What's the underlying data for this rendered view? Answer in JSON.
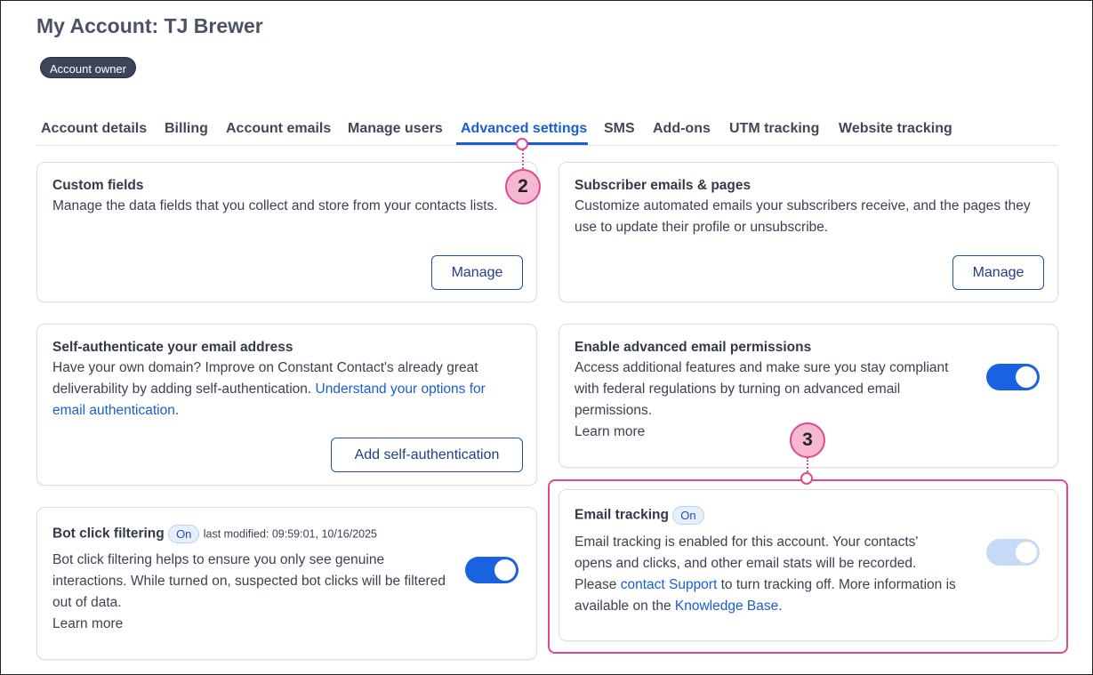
{
  "page": {
    "title": "My Account: TJ Brewer",
    "role_badge": "Account owner"
  },
  "tabs": [
    {
      "label": "Account details"
    },
    {
      "label": "Billing"
    },
    {
      "label": "Account emails"
    },
    {
      "label": "Manage users"
    },
    {
      "label": "Advanced settings",
      "active": true
    },
    {
      "label": "SMS"
    },
    {
      "label": "Add-ons"
    },
    {
      "label": "UTM tracking"
    },
    {
      "label": "Website tracking"
    }
  ],
  "cards": {
    "custom_fields": {
      "title": "Custom fields",
      "description": "Manage the data fields that you collect and store from your contacts lists.",
      "button": "Manage"
    },
    "subscriber_emails": {
      "title": "Subscriber emails & pages",
      "description": "Customize automated emails your subscribers receive, and the pages they use to update their profile or unsubscribe.",
      "button": "Manage"
    },
    "self_auth": {
      "title": "Self-authenticate your email address",
      "description_prefix": "Have your own domain? Improve on Constant Contact's already great deliverability by adding self-authentication. ",
      "link": "Understand your options for email authentication",
      "description_suffix": ".",
      "button": "Add self-authentication"
    },
    "advanced_permissions": {
      "title": "Enable advanced email permissions",
      "description": "Access additional features and make sure you stay compliant with federal regulations by turning on advanced email permissions.",
      "link": "Learn more",
      "toggle_on": true
    },
    "bot_click": {
      "title": "Bot click filtering",
      "status": "On",
      "modified": "last modified: 09:59:01, 10/16/2025",
      "description": "Bot click filtering helps to ensure you only see genuine interactions. While turned on, suspected bot clicks will be filtered out of data.",
      "link": "Learn more",
      "toggle_on": true
    },
    "email_tracking": {
      "title": "Email tracking",
      "status": "On",
      "description_1": "Email tracking is enabled for this account. Your contacts' opens and clicks, and other email stats will be recorded. Please ",
      "link_1": "contact Support",
      "description_2": " to turn tracking off. More information is available on the ",
      "link_2": "Knowledge Base",
      "description_3": ".",
      "toggle_on": true,
      "toggle_disabled": true
    }
  },
  "callouts": {
    "step_2": "2",
    "step_3": "3"
  },
  "colors": {
    "accent": "#1a5fd1",
    "callout": "#e0498e",
    "callout_fill": "#f6b7d2"
  }
}
